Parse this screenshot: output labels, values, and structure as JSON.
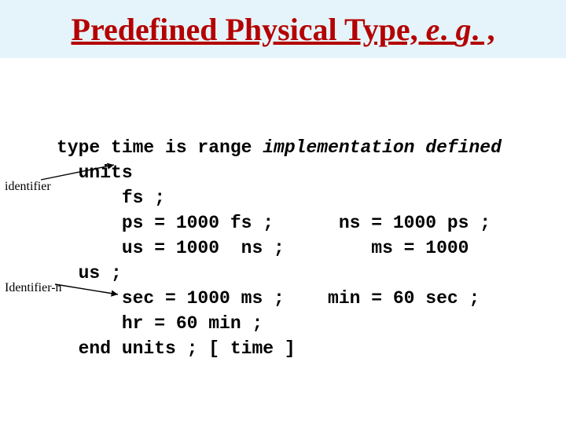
{
  "title": {
    "main": "Predefined Physical Type, ",
    "eg_e": "e",
    "dot1": ". ",
    "eg_g": "g",
    "dot2": ". ,"
  },
  "code": {
    "l1_a": "type time is range ",
    "l1_b": "implementation defined",
    "l2": "  units",
    "l3": "      fs ;",
    "l4": "      ps = 1000 fs ;      ns = 1000 ps ;",
    "l5": "      us = 1000  ns ;        ms = 1000",
    "l6": "  us ;",
    "l7": "      sec = 1000 ms ;    min = 60 sec ;",
    "l8": "      hr = 60 min ;",
    "l9": "  end units ; [ time ]"
  },
  "labels": {
    "identifier": "identifier",
    "identifier_n": "Identifier-n"
  }
}
